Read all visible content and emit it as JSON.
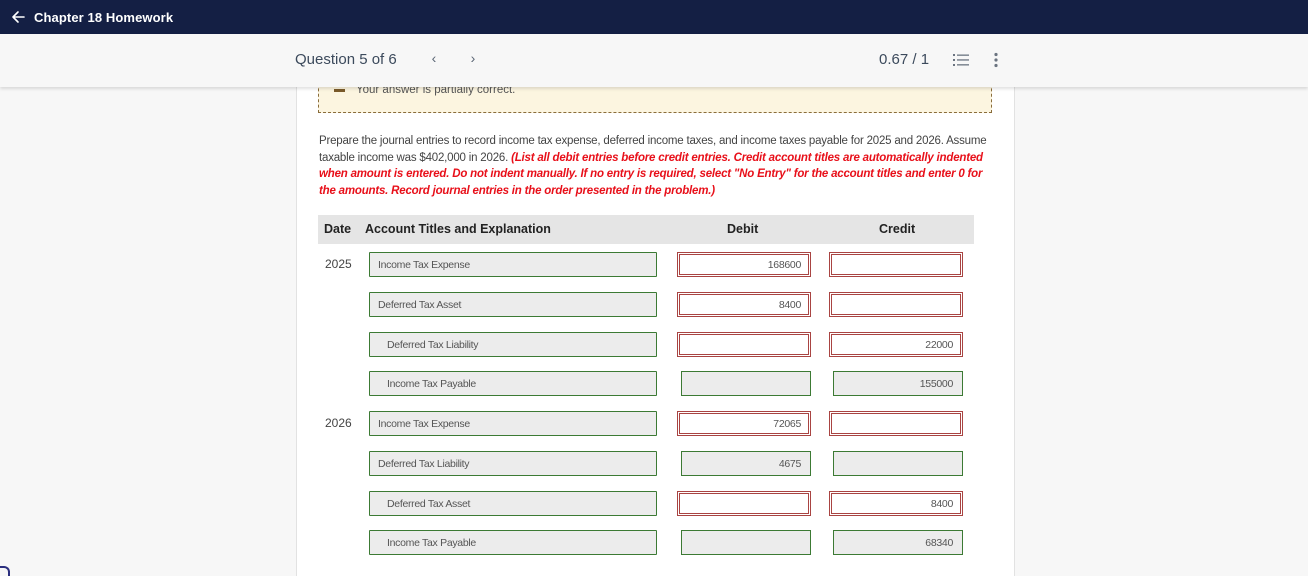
{
  "topbar": {
    "back_icon": "arrow-left-icon",
    "title": "Chapter 18 Homework"
  },
  "question_bar": {
    "label": "Question 5 of 6",
    "prev_icon": "chevron-left-icon",
    "prev_glyph": "‹",
    "next_icon": "chevron-right-icon",
    "next_glyph": "›",
    "score": "0.67 / 1",
    "list_icon": "numbered-list-icon",
    "more_icon": "more-vertical-icon"
  },
  "banner": {
    "status_icon": "partial-dash-icon",
    "message": "Your answer is partially correct.",
    "color": "#fcf5e0"
  },
  "prompt": {
    "text": "Prepare the journal entries to record income tax expense, deferred income taxes, and income taxes payable for 2025 and 2026. Assume taxable income was $402,000 in 2026. ",
    "instructions": "(List all debit entries before credit entries. Credit account titles are automatically indented when amount is entered. Do not indent manually. If no entry is required, select \"No Entry\" for the account titles and enter 0 for the amounts. Record journal entries in the order presented in the problem.)",
    "instructions_color": "#e8101a"
  },
  "table": {
    "headers": {
      "date": "Date",
      "account": "Account Titles and Explanation",
      "debit": "Debit",
      "credit": "Credit"
    },
    "status_colors": {
      "correct_border": "#3c7a34",
      "incorrect_border": "#a94442"
    },
    "rows": [
      {
        "date": "2025",
        "account": "Income Tax Expense",
        "indent": 0,
        "debit": "168600",
        "credit": "",
        "debit_status": "incorrect",
        "credit_status": "incorrect"
      },
      {
        "date": "",
        "account": "Deferred Tax Asset",
        "indent": 0,
        "debit": "8400",
        "credit": "",
        "debit_status": "incorrect",
        "credit_status": "incorrect"
      },
      {
        "date": "",
        "account": "Deferred Tax Liability",
        "indent": 1,
        "debit": "",
        "credit": "22000",
        "debit_status": "incorrect",
        "credit_status": "incorrect"
      },
      {
        "date": "",
        "account": "Income Tax Payable",
        "indent": 1,
        "debit": "",
        "credit": "155000",
        "debit_status": "correct",
        "credit_status": "correct"
      },
      {
        "date": "2026",
        "account": "Income Tax Expense",
        "indent": 0,
        "debit": "72065",
        "credit": "",
        "debit_status": "incorrect",
        "credit_status": "incorrect"
      },
      {
        "date": "",
        "account": "Deferred Tax Liability",
        "indent": 0,
        "debit": "4675",
        "credit": "",
        "debit_status": "correct",
        "credit_status": "correct"
      },
      {
        "date": "",
        "account": "Deferred Tax Asset",
        "indent": 1,
        "debit": "",
        "credit": "8400",
        "debit_status": "incorrect",
        "credit_status": "incorrect"
      },
      {
        "date": "",
        "account": "Income Tax Payable",
        "indent": 1,
        "debit": "",
        "credit": "68340",
        "debit_status": "correct",
        "credit_status": "correct"
      }
    ]
  }
}
